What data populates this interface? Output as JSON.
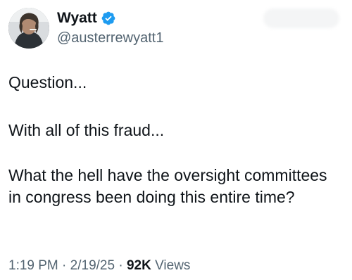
{
  "author": {
    "display_name": "Wyatt",
    "handle": "@austerrewyatt1",
    "verified": true,
    "verified_icon": "verified-badge-icon",
    "verified_color": "#1d9bf0"
  },
  "tweet": {
    "paragraphs": [
      "Question...",
      "With all of this fraud...",
      "What the hell have the oversight committees in congress been doing this entire time?"
    ]
  },
  "meta": {
    "time": "1:19 PM",
    "separator": "·",
    "date": "2/19/25",
    "views_count": "92K",
    "views_label": "Views"
  },
  "colors": {
    "text": "#0f1419",
    "secondary": "#536471"
  }
}
